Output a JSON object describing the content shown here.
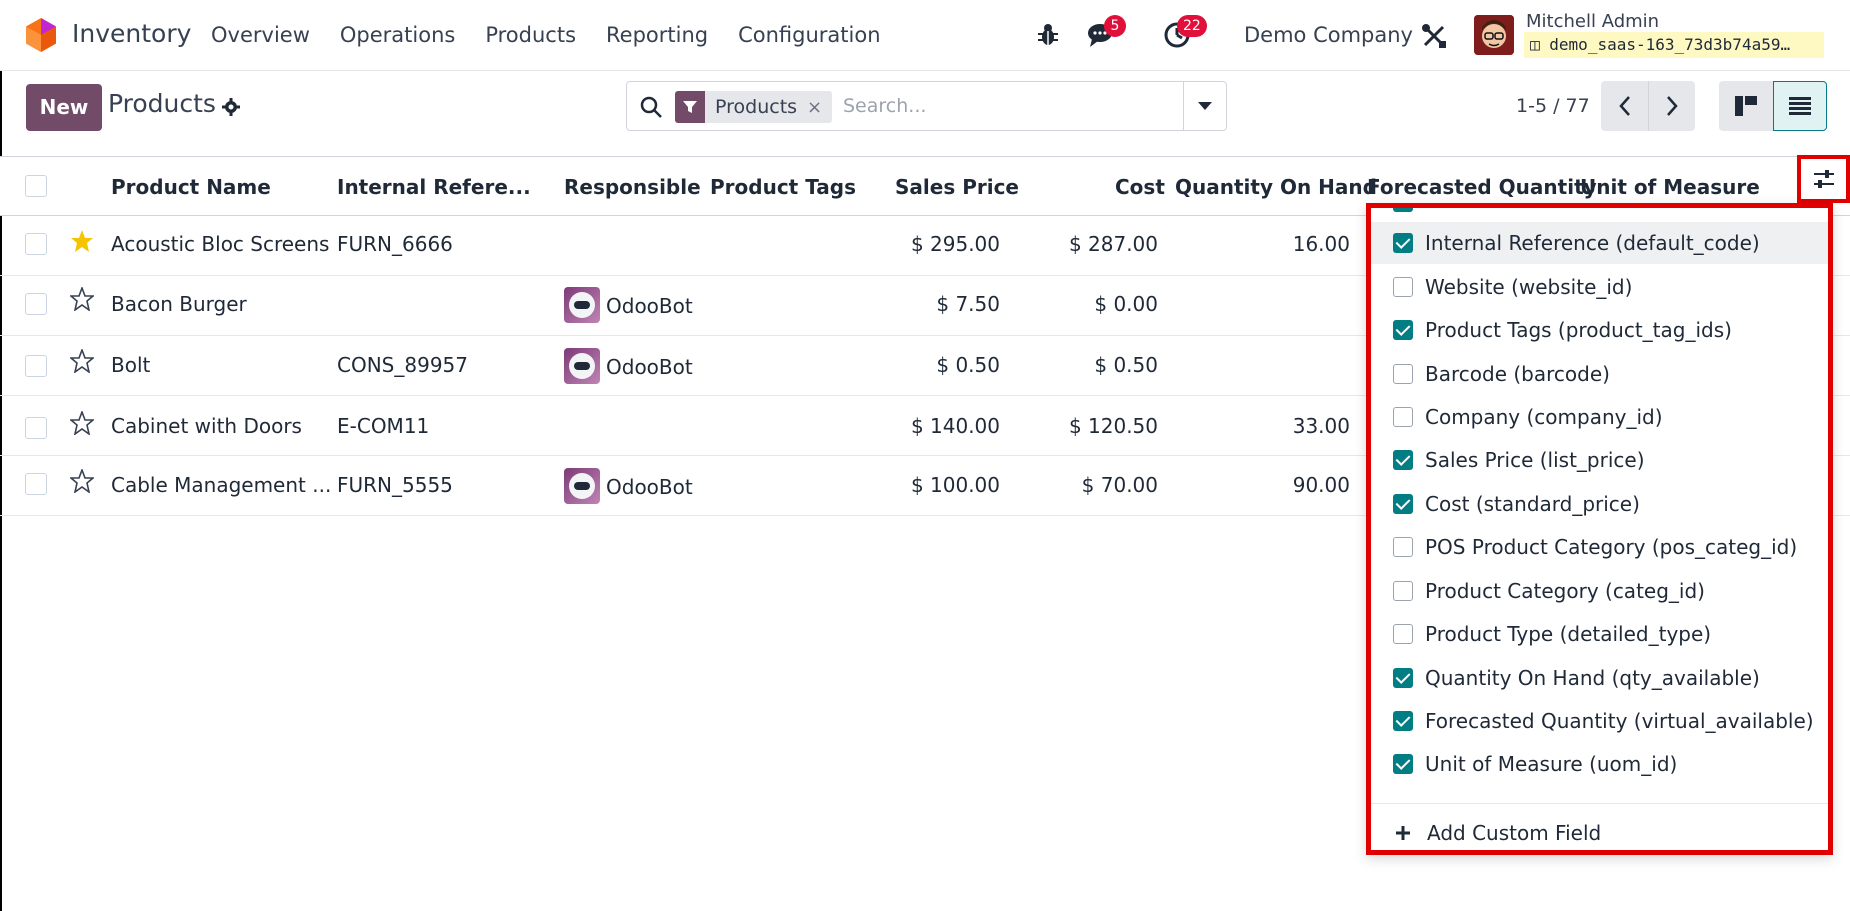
{
  "navbar": {
    "app_name": "Inventory",
    "menu": [
      "Overview",
      "Operations",
      "Products",
      "Reporting",
      "Configuration"
    ],
    "messages_count": "5",
    "activities_count": "22",
    "company": "Demo Company",
    "user_name": "Mitchell Admin",
    "database": "demo_saas-163_73d3b74a59…"
  },
  "control": {
    "new_label": "New",
    "title": "Products",
    "facet_label": "Products",
    "facet_remove": "×",
    "search_placeholder": "Search...",
    "pager": "1-5 / 77"
  },
  "table": {
    "headers": [
      "Product Name",
      "Internal Refere...",
      "Responsible",
      "Product Tags",
      "Sales Price",
      "Cost",
      "Quantity On Hand",
      "Forecasted Quantity",
      "Unit of Measure"
    ],
    "rows": [
      {
        "name": "Acoustic Bloc Screens",
        "ref": "FURN_6666",
        "responsible": "",
        "price": "$ 295.00",
        "cost": "$ 287.00",
        "qty": "16.00",
        "favorite": true
      },
      {
        "name": "Bacon Burger",
        "ref": "",
        "responsible": "OdooBot",
        "price": "$ 7.50",
        "cost": "$ 0.00",
        "qty": "",
        "favorite": false
      },
      {
        "name": "Bolt",
        "ref": "CONS_89957",
        "responsible": "OdooBot",
        "price": "$ 0.50",
        "cost": "$ 0.50",
        "qty": "",
        "favorite": false
      },
      {
        "name": "Cabinet with Doors",
        "ref": "E-COM11",
        "responsible": "",
        "price": "$ 140.00",
        "cost": "$ 120.50",
        "qty": "33.00",
        "favorite": false
      },
      {
        "name": "Cable Management ...",
        "ref": "FURN_5555",
        "responsible": "OdooBot",
        "price": "$ 100.00",
        "cost": "$ 70.00",
        "qty": "90.00",
        "favorite": false
      }
    ]
  },
  "optional_columns": {
    "items": [
      {
        "label": "Internal Reference (default_code)",
        "checked": true
      },
      {
        "label": "Website (website_id)",
        "checked": false
      },
      {
        "label": "Product Tags (product_tag_ids)",
        "checked": true
      },
      {
        "label": "Barcode (barcode)",
        "checked": false
      },
      {
        "label": "Company (company_id)",
        "checked": false
      },
      {
        "label": "Sales Price (list_price)",
        "checked": true
      },
      {
        "label": "Cost (standard_price)",
        "checked": true
      },
      {
        "label": "POS Product Category (pos_categ_id)",
        "checked": false
      },
      {
        "label": "Product Category (categ_id)",
        "checked": false
      },
      {
        "label": "Product Type (detailed_type)",
        "checked": false
      },
      {
        "label": "Quantity On Hand (qty_available)",
        "checked": true
      },
      {
        "label": "Forecasted Quantity (virtual_available)",
        "checked": true
      },
      {
        "label": "Unit of Measure (uom_id)",
        "checked": true
      }
    ],
    "add_custom_field": "Add Custom Field"
  },
  "colors": {
    "brand": "#714b67",
    "accent_teal": "#017e84",
    "highlight_red": "#e00000",
    "badge_red": "#e0103b",
    "favorite_star": "#f5c400"
  }
}
